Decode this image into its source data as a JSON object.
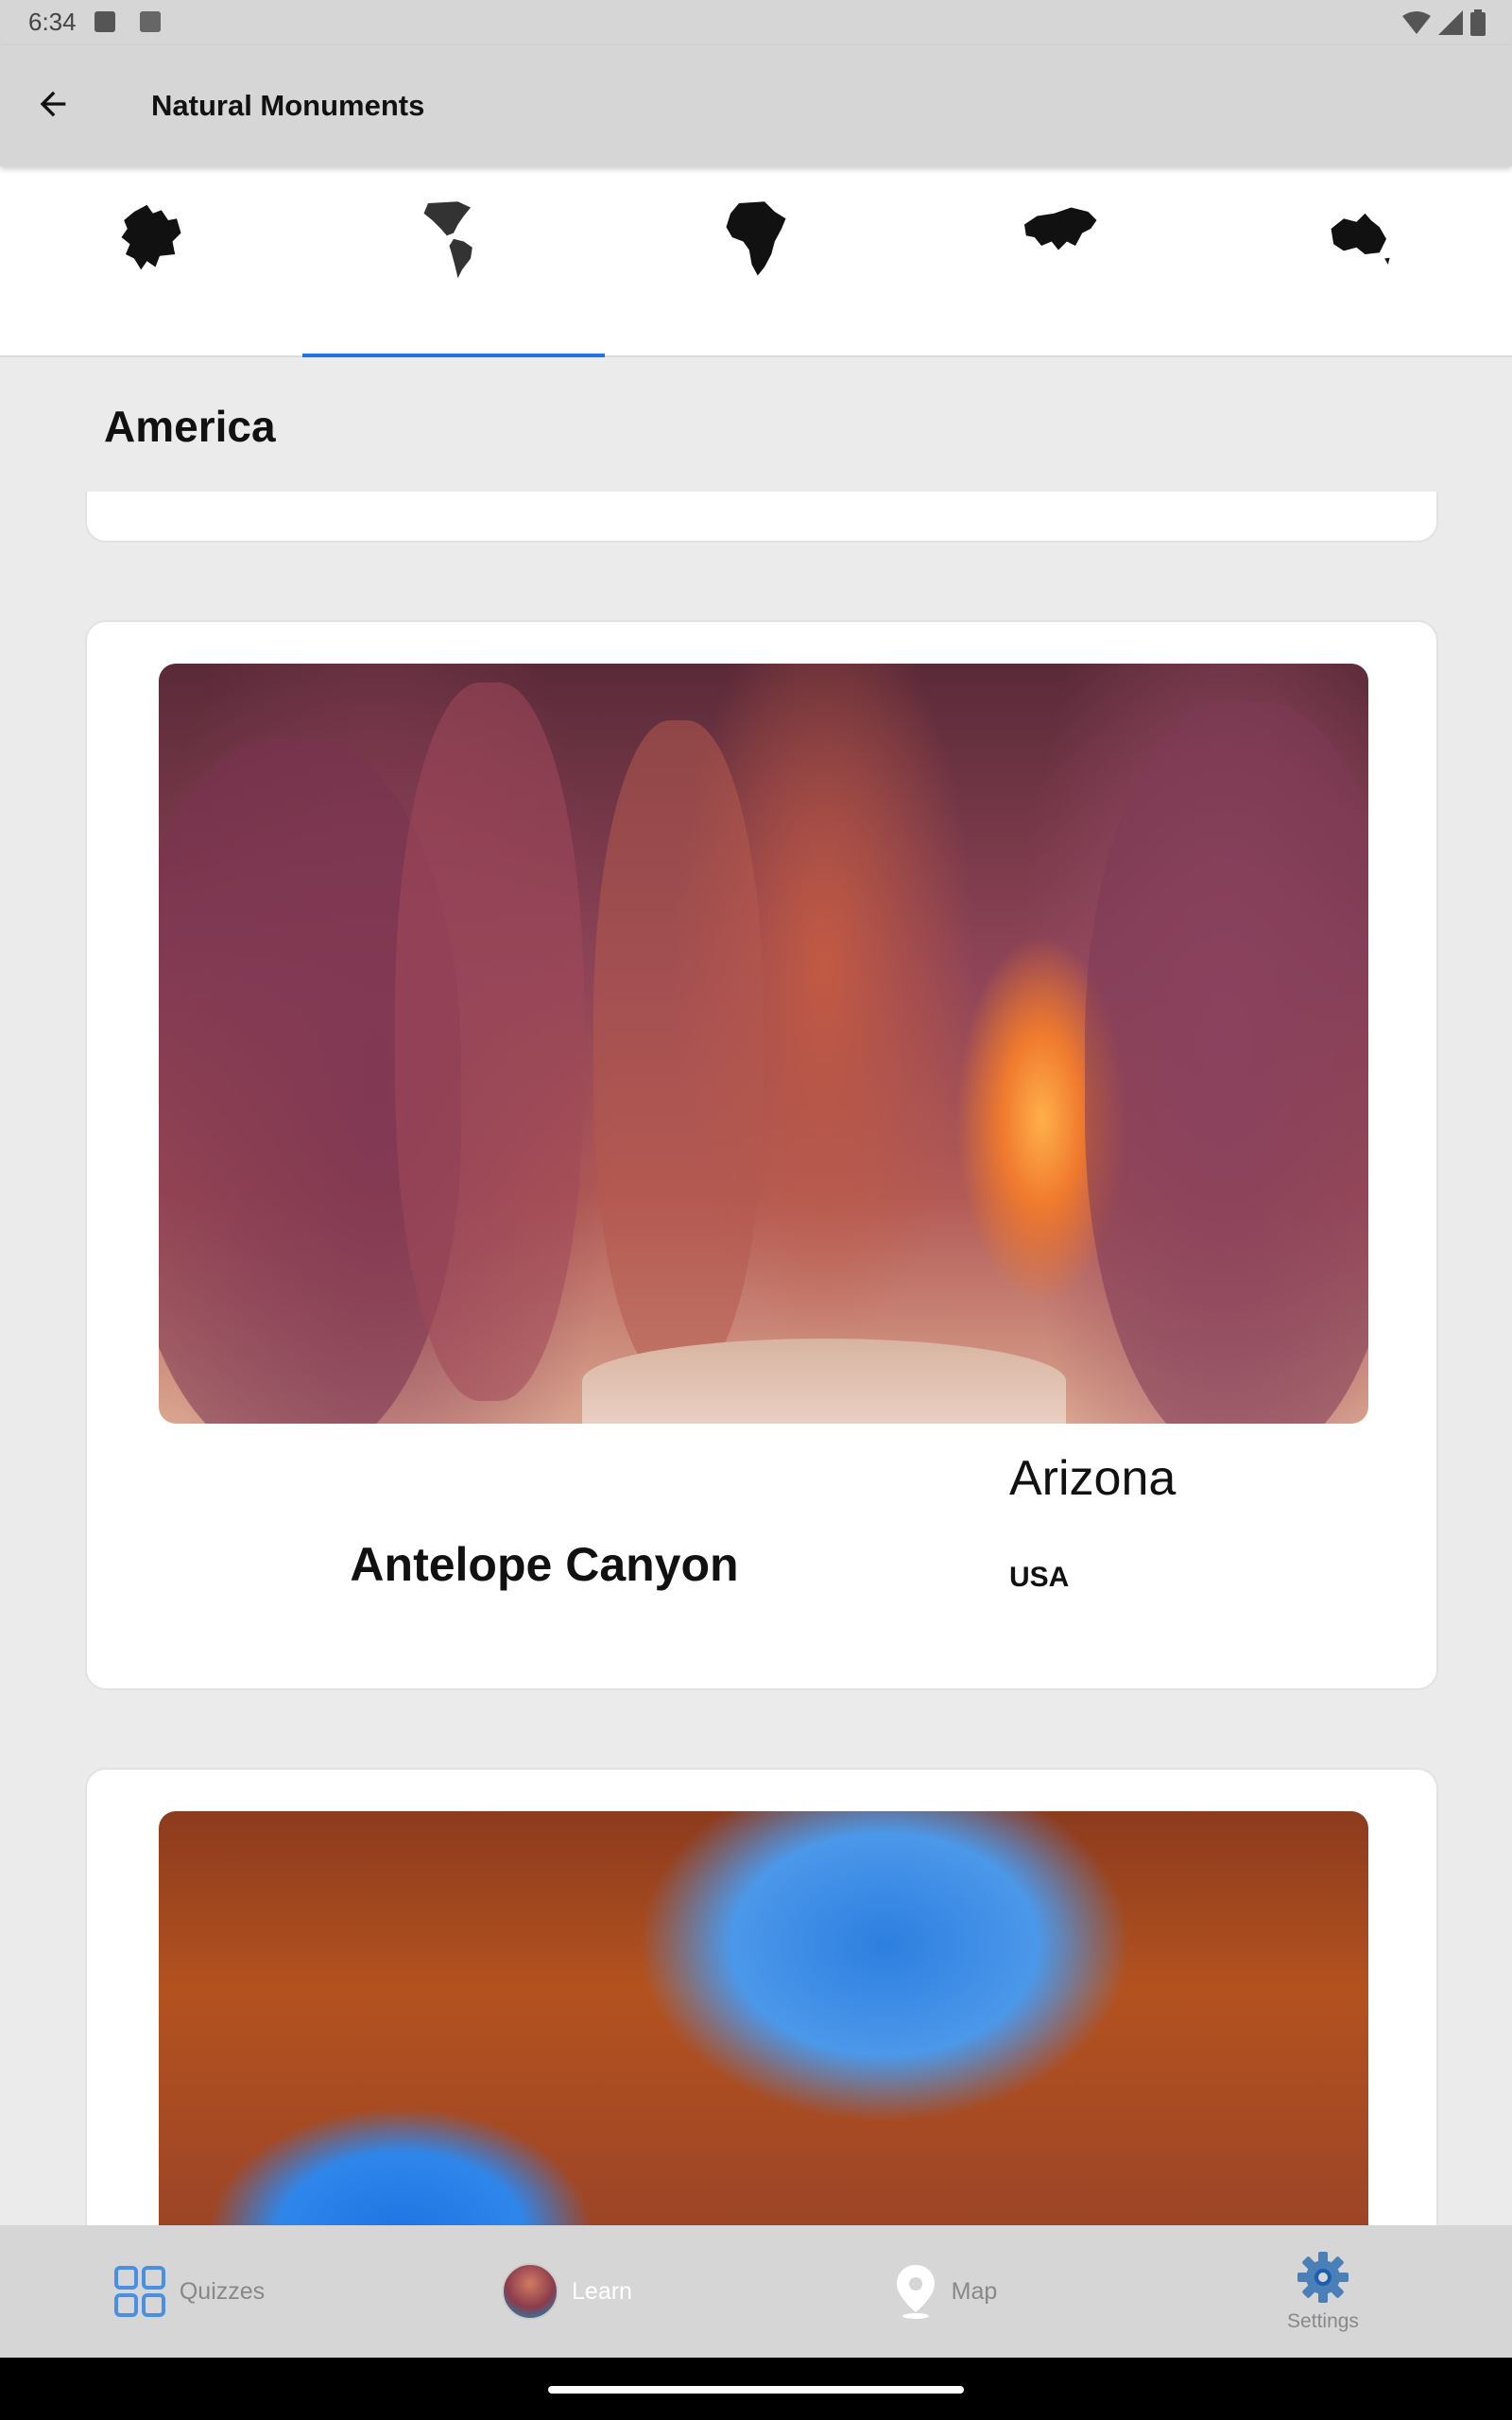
{
  "status_bar": {
    "time": "6:34"
  },
  "app_bar": {
    "title": "Natural Monuments",
    "back_icon": "arrow-left-icon"
  },
  "continent_tabs": [
    {
      "id": "europe",
      "icon": "europe-map-icon",
      "selected": false
    },
    {
      "id": "america",
      "icon": "americas-map-icon",
      "selected": true
    },
    {
      "id": "africa",
      "icon": "africa-map-icon",
      "selected": false
    },
    {
      "id": "asia",
      "icon": "asia-map-icon",
      "selected": false
    },
    {
      "id": "oceania",
      "icon": "australia-map-icon",
      "selected": false
    }
  ],
  "section": {
    "title": "America"
  },
  "monuments": [
    {
      "name": "Antelope Canyon",
      "state": "Arizona",
      "country": "USA",
      "image": "canyon-photo"
    },
    {
      "name": "",
      "state": "",
      "country": "",
      "image": "arch-photo"
    }
  ],
  "bottom_nav": {
    "items": [
      {
        "label": "Quizzes",
        "icon": "grid-icon",
        "active": false
      },
      {
        "label": "Learn",
        "icon": "learn-avatar-icon",
        "active": true
      },
      {
        "label": "Map",
        "icon": "map-pin-icon",
        "active": false
      },
      {
        "label": "Settings",
        "icon": "gear-icon",
        "active": false
      }
    ]
  },
  "colors": {
    "accent": "#1e73e8",
    "app_bar": "#d6d6d6",
    "background": "#ebebeb"
  }
}
